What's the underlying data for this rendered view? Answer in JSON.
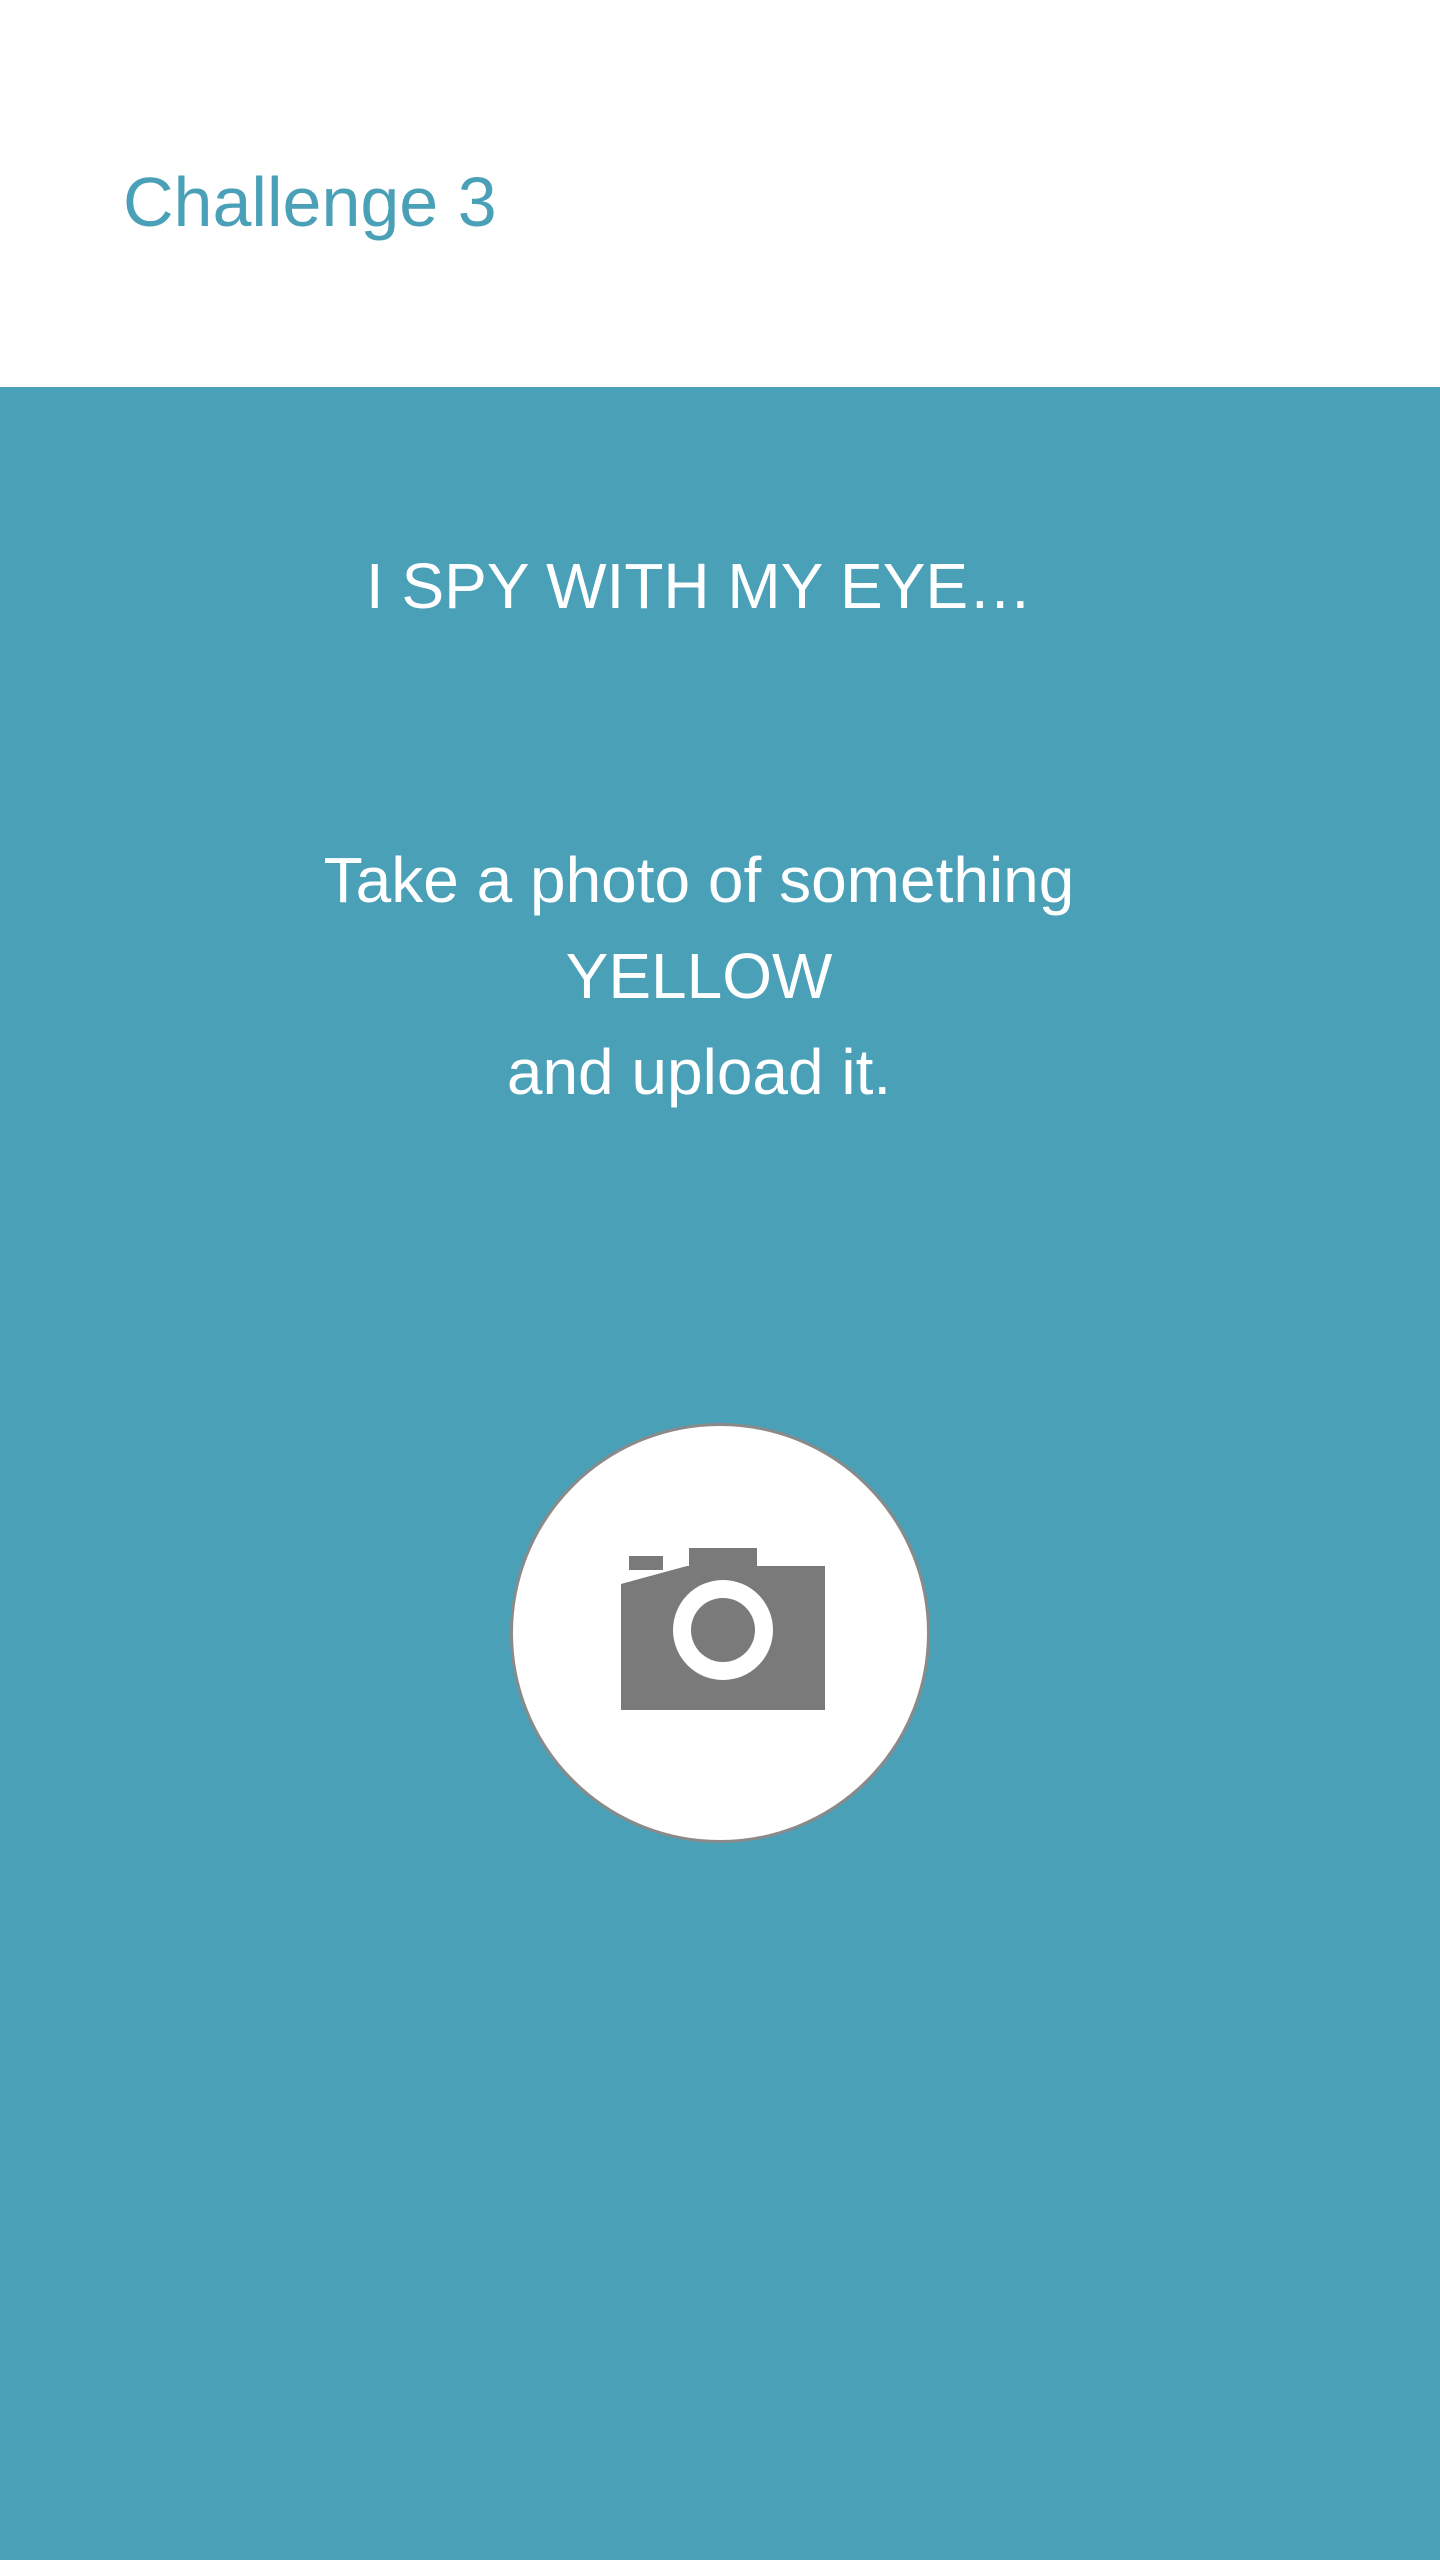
{
  "header": {
    "title": "Challenge 3"
  },
  "challenge": {
    "heading": "I SPY WITH MY EYE…",
    "instruction_lines": [
      "Take a photo of something",
      "YELLOW",
      "and upload it."
    ]
  },
  "upload": {
    "icon": "camera-icon"
  },
  "colors": {
    "accent": "#49a0b7",
    "header_background": "#ffffff",
    "button_background": "#ffffff",
    "icon": "#7a7a7a"
  }
}
